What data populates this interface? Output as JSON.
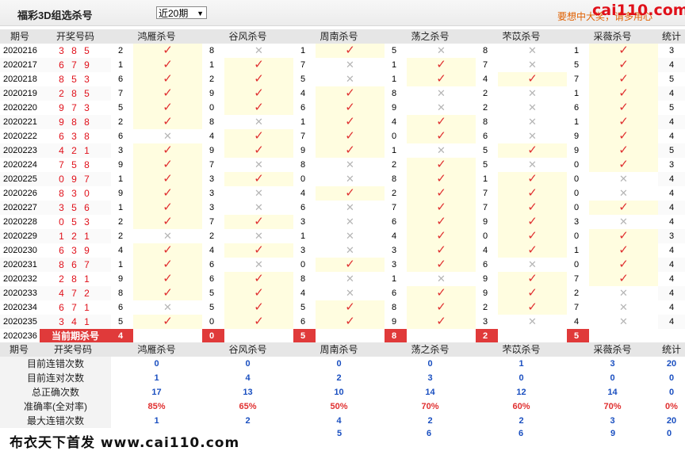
{
  "header": {
    "title": "福彩3D组选杀号",
    "period_select": "近20期",
    "promo": "要想中大奖，请多用心",
    "logo": "cai110.com"
  },
  "columns": [
    "期号",
    "开奖号码",
    "鸿雁杀号",
    "谷风杀号",
    "周南杀号",
    "荡之杀号",
    "芣苡杀号",
    "采薇杀号",
    "统计"
  ],
  "rows": [
    {
      "issue": "2020216",
      "num": "385",
      "kills": [
        [
          "2",
          "t"
        ],
        [
          "8",
          "x"
        ],
        [
          "1",
          "t"
        ],
        [
          "5",
          "x"
        ],
        [
          "8",
          "x"
        ],
        [
          "1",
          "t"
        ]
      ],
      "count": "3"
    },
    {
      "issue": "2020217",
      "num": "679",
      "kills": [
        [
          "1",
          "t"
        ],
        [
          "1",
          "t"
        ],
        [
          "7",
          "x"
        ],
        [
          "1",
          "t"
        ],
        [
          "7",
          "x"
        ],
        [
          "5",
          "t"
        ]
      ],
      "count": "4"
    },
    {
      "issue": "2020218",
      "num": "853",
      "kills": [
        [
          "6",
          "t"
        ],
        [
          "2",
          "t"
        ],
        [
          "5",
          "x"
        ],
        [
          "1",
          "t"
        ],
        [
          "4",
          "t"
        ],
        [
          "7",
          "t"
        ]
      ],
      "count": "5"
    },
    {
      "issue": "2020219",
      "num": "285",
      "kills": [
        [
          "7",
          "t"
        ],
        [
          "9",
          "t"
        ],
        [
          "4",
          "t"
        ],
        [
          "8",
          "x"
        ],
        [
          "2",
          "x"
        ],
        [
          "1",
          "t"
        ]
      ],
      "count": "4"
    },
    {
      "issue": "2020220",
      "num": "973",
      "kills": [
        [
          "5",
          "t"
        ],
        [
          "0",
          "t"
        ],
        [
          "6",
          "t"
        ],
        [
          "9",
          "x"
        ],
        [
          "2",
          "x"
        ],
        [
          "6",
          "t"
        ]
      ],
      "count": "5"
    },
    {
      "issue": "2020221",
      "num": "988",
      "kills": [
        [
          "2",
          "t"
        ],
        [
          "8",
          "x"
        ],
        [
          "1",
          "t"
        ],
        [
          "4",
          "t"
        ],
        [
          "8",
          "x"
        ],
        [
          "1",
          "t"
        ]
      ],
      "count": "4"
    },
    {
      "issue": "2020222",
      "num": "638",
      "kills": [
        [
          "6",
          "x"
        ],
        [
          "4",
          "t"
        ],
        [
          "7",
          "t"
        ],
        [
          "0",
          "t"
        ],
        [
          "6",
          "x"
        ],
        [
          "9",
          "t"
        ]
      ],
      "count": "4"
    },
    {
      "issue": "2020223",
      "num": "421",
      "kills": [
        [
          "3",
          "t"
        ],
        [
          "9",
          "t"
        ],
        [
          "9",
          "t"
        ],
        [
          "1",
          "x"
        ],
        [
          "5",
          "t"
        ],
        [
          "9",
          "t"
        ]
      ],
      "count": "5"
    },
    {
      "issue": "2020224",
      "num": "758",
      "kills": [
        [
          "9",
          "t"
        ],
        [
          "7",
          "x"
        ],
        [
          "8",
          "x"
        ],
        [
          "2",
          "t"
        ],
        [
          "5",
          "x"
        ],
        [
          "0",
          "t"
        ]
      ],
      "count": "3"
    },
    {
      "issue": "2020225",
      "num": "097",
      "kills": [
        [
          "1",
          "t"
        ],
        [
          "3",
          "t"
        ],
        [
          "0",
          "x"
        ],
        [
          "8",
          "t"
        ],
        [
          "1",
          "t"
        ],
        [
          "0",
          "x"
        ]
      ],
      "count": "4"
    },
    {
      "issue": "2020226",
      "num": "830",
      "kills": [
        [
          "9",
          "t"
        ],
        [
          "3",
          "x"
        ],
        [
          "4",
          "t"
        ],
        [
          "2",
          "t"
        ],
        [
          "7",
          "t"
        ],
        [
          "0",
          "x"
        ]
      ],
      "count": "4"
    },
    {
      "issue": "2020227",
      "num": "356",
      "kills": [
        [
          "1",
          "t"
        ],
        [
          "3",
          "x"
        ],
        [
          "6",
          "x"
        ],
        [
          "7",
          "t"
        ],
        [
          "7",
          "t"
        ],
        [
          "0",
          "t"
        ]
      ],
      "count": "4"
    },
    {
      "issue": "2020228",
      "num": "053",
      "kills": [
        [
          "2",
          "t"
        ],
        [
          "7",
          "t"
        ],
        [
          "3",
          "x"
        ],
        [
          "6",
          "t"
        ],
        [
          "9",
          "t"
        ],
        [
          "3",
          "x"
        ]
      ],
      "count": "4"
    },
    {
      "issue": "2020229",
      "num": "121",
      "kills": [
        [
          "2",
          "x"
        ],
        [
          "2",
          "x"
        ],
        [
          "1",
          "x"
        ],
        [
          "4",
          "t"
        ],
        [
          "0",
          "t"
        ],
        [
          "0",
          "t"
        ]
      ],
      "count": "3"
    },
    {
      "issue": "2020230",
      "num": "639",
      "kills": [
        [
          "4",
          "t"
        ],
        [
          "4",
          "t"
        ],
        [
          "3",
          "x"
        ],
        [
          "3",
          "t"
        ],
        [
          "4",
          "t"
        ],
        [
          "1",
          "t"
        ]
      ],
      "count": "4"
    },
    {
      "issue": "2020231",
      "num": "867",
      "kills": [
        [
          "1",
          "t"
        ],
        [
          "6",
          "x"
        ],
        [
          "0",
          "t"
        ],
        [
          "3",
          "t"
        ],
        [
          "6",
          "x"
        ],
        [
          "0",
          "t"
        ]
      ],
      "count": "4"
    },
    {
      "issue": "2020232",
      "num": "281",
      "kills": [
        [
          "9",
          "t"
        ],
        [
          "6",
          "t"
        ],
        [
          "8",
          "x"
        ],
        [
          "1",
          "x"
        ],
        [
          "9",
          "t"
        ],
        [
          "7",
          "t"
        ]
      ],
      "count": "4"
    },
    {
      "issue": "2020233",
      "num": "472",
      "kills": [
        [
          "8",
          "t"
        ],
        [
          "5",
          "t"
        ],
        [
          "4",
          "x"
        ],
        [
          "6",
          "t"
        ],
        [
          "9",
          "t"
        ],
        [
          "2",
          "x"
        ]
      ],
      "count": "4"
    },
    {
      "issue": "2020234",
      "num": "671",
      "kills": [
        [
          "6",
          "x"
        ],
        [
          "5",
          "t"
        ],
        [
          "5",
          "t"
        ],
        [
          "8",
          "t"
        ],
        [
          "2",
          "t"
        ],
        [
          "7",
          "x"
        ]
      ],
      "count": "4"
    },
    {
      "issue": "2020235",
      "num": "341",
      "kills": [
        [
          "5",
          "t"
        ],
        [
          "0",
          "t"
        ],
        [
          "6",
          "t"
        ],
        [
          "9",
          "t"
        ],
        [
          "3",
          "x"
        ],
        [
          "4",
          "x"
        ]
      ],
      "count": "4"
    }
  ],
  "current": {
    "issue": "2020236",
    "label": "当前期杀号",
    "kills": [
      "4",
      "0",
      "5",
      "8",
      "2",
      "5"
    ]
  },
  "stats_columns": [
    "期号",
    "开奖号码",
    "鸿雁杀号",
    "谷风杀号",
    "周南杀号",
    "荡之杀号",
    "芣苡杀号",
    "采薇杀号",
    "统计"
  ],
  "stats": [
    {
      "label": "目前连错次数",
      "values": [
        "0",
        "0",
        "0",
        "0",
        "1",
        "3",
        "20"
      ]
    },
    {
      "label": "目前连对次数",
      "values": [
        "1",
        "4",
        "2",
        "3",
        "0",
        "0",
        "0"
      ]
    },
    {
      "label": "总正确次数",
      "values": [
        "17",
        "13",
        "10",
        "14",
        "12",
        "14",
        "0"
      ]
    },
    {
      "label": "准确率(全对率)",
      "values": [
        "85%",
        "65%",
        "50%",
        "70%",
        "60%",
        "70%",
        "0%"
      ],
      "red": true
    },
    {
      "label": "最大连错次数",
      "values": [
        "1",
        "2",
        "4",
        "2",
        "2",
        "3",
        "20"
      ]
    }
  ],
  "last_row_values": [
    "5",
    "6",
    "6",
    "9",
    "0"
  ],
  "footer": "布衣天下首发 www.cai110.com",
  "colors": {
    "tick": "#e03030",
    "cross": "#b5b5b5",
    "current_bg": "#e03a3a",
    "stat_value": "#1a4fc0",
    "number": "#e0101a"
  }
}
